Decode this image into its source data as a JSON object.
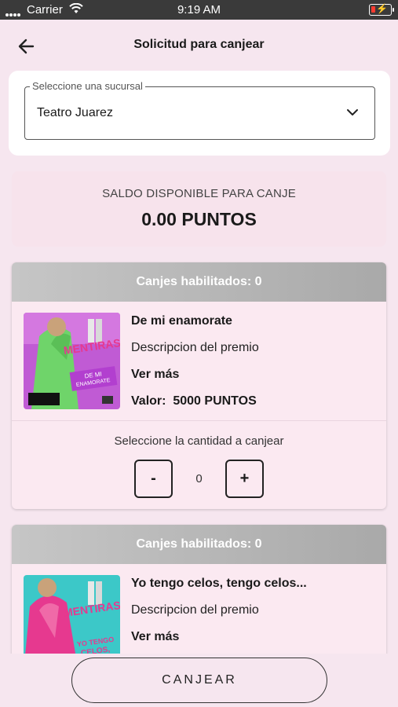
{
  "status_bar": {
    "carrier": "Carrier",
    "time": "9:19 AM"
  },
  "header": {
    "title": "Solicitud para canjear"
  },
  "branch": {
    "legend": "Seleccione una sucursal",
    "selected": "Teatro Juarez"
  },
  "balance": {
    "label": "SALDO DISPONIBLE PARA CANJE",
    "value": "0.00 PUNTOS"
  },
  "rewards": [
    {
      "header": "Canjes habilitados: 0",
      "name": "De mi enamorate",
      "description": "Descripcion del premio",
      "more": "Ver más",
      "value_label": "Valor:",
      "value": "5000 PUNTOS",
      "quantity_label": "Seleccione la cantidad a canjear",
      "quantity": "0",
      "minus": "-",
      "plus": "+",
      "thumb_colors": [
        "#c05bd4",
        "#6fd46a"
      ]
    },
    {
      "header": "Canjes habilitados: 0",
      "name": "Yo tengo celos, tengo celos...",
      "description": "Descripcion del premio",
      "more": "Ver más",
      "thumb_colors": [
        "#3cc8c8",
        "#e6398f"
      ]
    }
  ],
  "footer": {
    "redeem_label": "CANJEAR"
  },
  "colors": {
    "background": "#f6e6ef",
    "card_header": "#b8b8b8",
    "accent_pink": "#e6398f"
  }
}
